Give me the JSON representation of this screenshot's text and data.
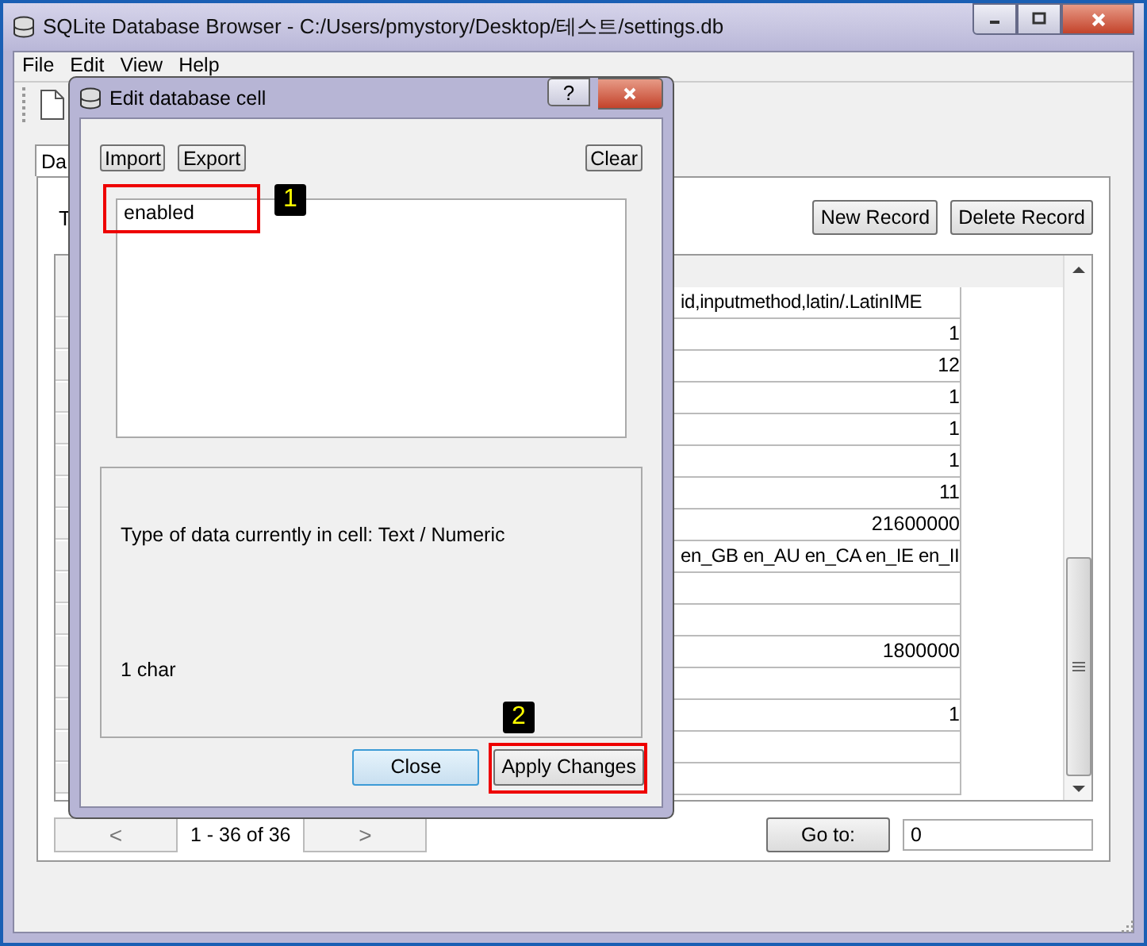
{
  "window": {
    "title": "SQLite Database Browser - C:/Users/pmystory/Desktop/테스트/settings.db"
  },
  "menu": [
    "File",
    "Edit",
    "View",
    "Help"
  ],
  "tabs": [
    {
      "label": "Da",
      "selected": true
    }
  ],
  "table_label": "T",
  "record_buttons": [
    "New Record",
    "Delete Record"
  ],
  "table": {
    "rows": [
      {
        "column_2": "id,inputmethod,latin/.LatinIME",
        "kind": "text"
      },
      {
        "column_2": "1",
        "kind": "number"
      },
      {
        "column_2": "12",
        "kind": "number"
      },
      {
        "column_2": "1",
        "kind": "number"
      },
      {
        "column_2": "1",
        "kind": "number"
      },
      {
        "column_2": "1",
        "kind": "number"
      },
      {
        "column_2": "11",
        "kind": "number"
      },
      {
        "column_2": "21600000",
        "kind": "number"
      },
      {
        "column_2": "en_GB en_AU en_CA en_IE en_II",
        "kind": "text"
      },
      {},
      {},
      {
        "column_2": "1800000",
        "kind": "number"
      },
      {},
      {
        "column_2": "1",
        "kind": "number"
      },
      {},
      {}
    ]
  },
  "pager": {
    "prev": "<",
    "range": "1 - 36 of 36",
    "next": ">",
    "goto_button": "Go to:",
    "goto_value": "0"
  },
  "dialog": {
    "title": "Edit database cell",
    "help": "?",
    "tools": [
      "Import",
      "Export",
      "Clear"
    ],
    "value": "enabled",
    "info": "Type of data currently in cell: Text / Numeric",
    "size": "1 char",
    "buttons": [
      {
        "label": "Close",
        "default": true
      },
      {
        "label": "Apply Changes",
        "default": false
      }
    ]
  },
  "callouts": [
    {
      "label": "1"
    },
    {
      "label": "2"
    }
  ]
}
